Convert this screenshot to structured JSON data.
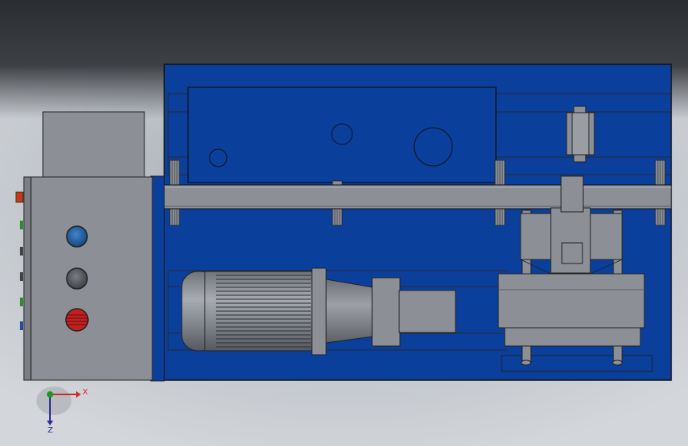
{
  "viewport": {
    "background_top": "#2a2d31",
    "background_bottom": "#d3d6da"
  },
  "model": {
    "base_plate_color": "#0b3f9c",
    "metal_color": "#8c9096",
    "edge_color": "#1a1a1a"
  },
  "control_panel": {
    "buttons": [
      {
        "name": "start-button",
        "color": "#1f5fa8"
      },
      {
        "name": "stop-button",
        "color": "#5a5d62"
      },
      {
        "name": "emergency-button",
        "color": "#c22020"
      }
    ],
    "indicator_colors": [
      "#c23a1a",
      "#2d8c2d",
      "#444",
      "#444",
      "#2d8c2d",
      "#2a4a9a"
    ]
  },
  "triad": {
    "x_label": "X",
    "z_label": "Z",
    "x_color": "#cc2a2a",
    "y_color": "#1a9a1a",
    "z_color": "#2a2a9a"
  }
}
